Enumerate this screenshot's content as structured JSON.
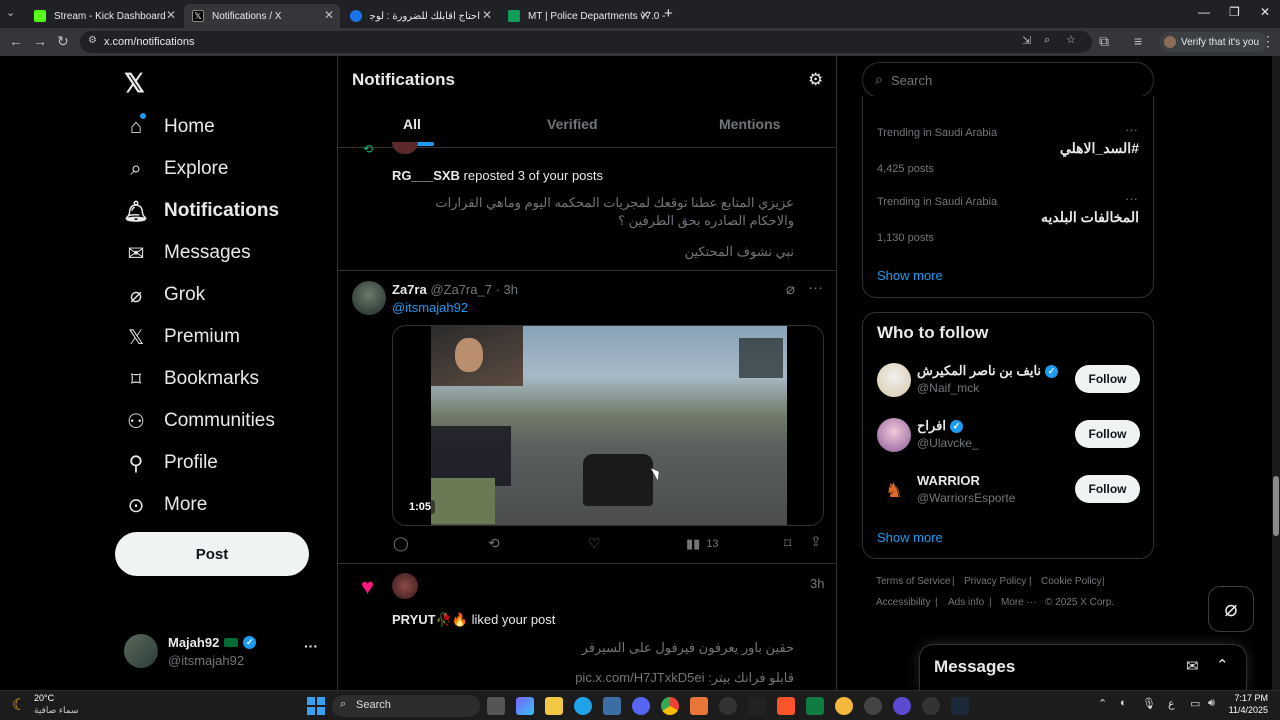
{
  "browser": {
    "tabs": [
      {
        "title": "Stream - Kick Dashboard",
        "active": false
      },
      {
        "title": "Notifications / X",
        "active": true
      },
      {
        "title": "احتاج اقابلك للضرورة : لوجود ادلة",
        "active": false
      },
      {
        "title": "MT | Police Departments v7.0 -",
        "active": false
      }
    ],
    "url": "x.com/notifications",
    "profile_label": "Verify that it's you"
  },
  "nav": {
    "items": [
      {
        "label": "Home",
        "icon": "home-icon"
      },
      {
        "label": "Explore",
        "icon": "search-icon"
      },
      {
        "label": "Notifications",
        "icon": "bell-icon"
      },
      {
        "label": "Messages",
        "icon": "mail-icon"
      },
      {
        "label": "Grok",
        "icon": "grok-icon"
      },
      {
        "label": "Premium",
        "icon": "x-logo-icon"
      },
      {
        "label": "Bookmarks",
        "icon": "bookmark-icon"
      },
      {
        "label": "Communities",
        "icon": "people-icon"
      },
      {
        "label": "Profile",
        "icon": "person-icon"
      },
      {
        "label": "More",
        "icon": "more-circle-icon"
      }
    ],
    "post_label": "Post",
    "account": {
      "name": "Majah92",
      "handle": "@itsmajah92",
      "more": "···"
    }
  },
  "feed": {
    "title": "Notifications",
    "tabs": [
      "All",
      "Verified",
      "Mentions"
    ],
    "repost_notice": {
      "user": "RG___SXB",
      "text": "reposted 3 of your posts",
      "quote1": "عزيزي المتابع عطنا توقعك لمجريات المحكمه اليوم وماهي القرارات والاحكام الصادره بحق الطرفين ؟",
      "quote2": "نبي نشوف المحتكين"
    },
    "post": {
      "name": "Za7ra",
      "handle": "@Za7ra_7",
      "time": "3h",
      "mention": "@itsmajah92",
      "video_duration": "1:05",
      "views": "13"
    },
    "like_notice": {
      "time": "3h",
      "user": "PRYUT🥀🔥",
      "text": "liked your post",
      "quote1": "حقين باور يعرفون فيرفول على السيرفر",
      "quote2": "قابلو فرانك بيتر: pic.x.com/H7JTxkD5ei"
    }
  },
  "sidebar": {
    "search_placeholder": "Search",
    "trends": [
      {
        "context": "Trending in Saudi Arabia",
        "title": "#السد_الاهلي",
        "posts": "4,425 posts"
      },
      {
        "context": "Trending in Saudi Arabia",
        "title": "المخالفات البلديه",
        "posts": "1,130 posts"
      }
    ],
    "trends_show_more": "Show more",
    "wtf_title": "Who to follow",
    "who_to_follow": [
      {
        "name": "نايف بن ناصر المكيرش",
        "handle": "@Naif_mck",
        "verified": true,
        "button": "Follow"
      },
      {
        "name": "افراح",
        "handle": "@Ulavcke_",
        "verified": true,
        "button": "Follow"
      },
      {
        "name": "WARRIOR",
        "handle": "@WarriorsEsporte",
        "verified": false,
        "button": "Follow"
      }
    ],
    "wtf_show_more": "Show more",
    "footer": [
      "Terms of Service",
      "Privacy Policy",
      "Cookie Policy",
      "Accessibility",
      "Ads info",
      "More ···",
      "© 2025 X Corp."
    ],
    "messages_title": "Messages"
  },
  "taskbar": {
    "weather_temp": "20°C",
    "weather_desc": "سماء صافية",
    "search_label": "Search",
    "time": "7:17 PM",
    "date": "11/4/2025"
  }
}
